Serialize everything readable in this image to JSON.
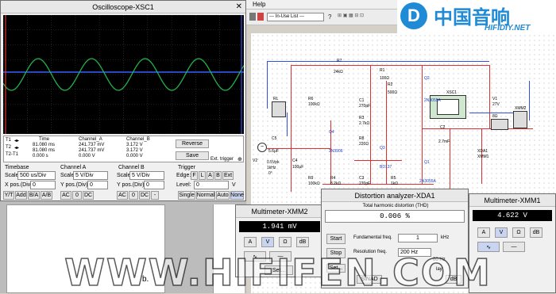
{
  "menu": {
    "help": "Help",
    "in_use_list": "--- In-Use List ---"
  },
  "brand": {
    "cn": "中国音响",
    "en": "HIFIDIY.NET",
    "color": "#1f8ad6"
  },
  "watermark": {
    "text": "WWW.HIFIFEN.COM"
  },
  "osc": {
    "title": "Oscilloscope-XSC1",
    "trace_color": "#22b14c",
    "cursor_labels": [
      "T1",
      "T2",
      "T2-T1"
    ],
    "head": {
      "time": "Time",
      "cha": "Channel_A",
      "chb": "Channel_B"
    },
    "rows": [
      {
        "time": "81.080 ms",
        "a": "241.737 mV",
        "b": "3.172 V"
      },
      {
        "time": "81.080 ms",
        "a": "241.737 mV",
        "b": "3.172 V"
      },
      {
        "time": "0.000 s",
        "a": "0.000 V",
        "b": "0.000 V"
      }
    ],
    "reverse": "Reverse",
    "save": "Save",
    "ext_trigger": "Ext. trigger",
    "timebase": {
      "title": "Timebase",
      "scale_lbl": "Scale:",
      "scale": "500 us/Div",
      "xpos_lbl": "X pos.(Div):",
      "xpos": "0",
      "modes": [
        "Y/T",
        "Add",
        "B/A",
        "A/B"
      ]
    },
    "cha": {
      "title": "Channel A",
      "scale_lbl": "Scale:",
      "scale": "5 V/Div",
      "ypos_lbl": "Y pos.(Div):",
      "ypos": "0",
      "modes": [
        "AC",
        "0",
        "DC"
      ]
    },
    "chb": {
      "title": "Channel B",
      "scale_lbl": "Scale:",
      "scale": "5 V/Div",
      "ypos_lbl": "Y pos.(Div):",
      "ypos": "0",
      "modes": [
        "AC",
        "0",
        "DC",
        "-"
      ]
    },
    "trig": {
      "title": "Trigger",
      "edge_lbl": "Edge:",
      "edge": [
        "F",
        "L",
        "A",
        "B",
        "Ext"
      ],
      "level_lbl": "Level:",
      "level": "0",
      "unit": "V",
      "modes": [
        "Single",
        "Normal",
        "Auto",
        "None"
      ]
    }
  },
  "schem": {
    "labels": [
      {
        "id": "R7",
        "t": "R7"
      },
      {
        "id": "R7v",
        "t": "24kΩ"
      },
      {
        "id": "R1",
        "t": "R1"
      },
      {
        "id": "R1v",
        "t": "100Ω"
      },
      {
        "id": "R2",
        "t": "R2"
      },
      {
        "id": "R2v",
        "t": "500Ω"
      },
      {
        "id": "Q2",
        "t": "Q2"
      },
      {
        "id": "XSC1",
        "t": "XSC1"
      },
      {
        "id": "V1",
        "t": "V1"
      },
      {
        "id": "V1v",
        "t": "27V"
      },
      {
        "id": "R6",
        "t": "R6"
      },
      {
        "id": "R6v",
        "t": "100kΩ"
      },
      {
        "id": "C1",
        "t": "C1"
      },
      {
        "id": "C1v",
        "t": "270pF"
      },
      {
        "id": "R3",
        "t": "R3"
      },
      {
        "id": "R3v",
        "t": "2.7kΩ"
      },
      {
        "id": "Q4",
        "t": "Q4"
      },
      {
        "id": "C5",
        "t": "C5"
      },
      {
        "id": "C5v",
        "t": "5.6μF"
      },
      {
        "id": "R8",
        "t": "R8"
      },
      {
        "id": "R8v",
        "t": "220Ω"
      },
      {
        "id": "Q3",
        "t": "Q3"
      },
      {
        "id": "C2",
        "t": "C2"
      },
      {
        "id": "C2v",
        "t": "2.7mF"
      },
      {
        "id": "Q5",
        "t": "2N3055A"
      },
      {
        "id": "2N3906",
        "t": "2N3906"
      },
      {
        "id": "BD137",
        "t": "BD137"
      },
      {
        "id": "V2",
        "t": "V2"
      },
      {
        "id": "V2v",
        "t": "0.5Vpk"
      },
      {
        "id": "V2f",
        "t": "1kHz"
      },
      {
        "id": "V2p",
        "t": "0°"
      },
      {
        "id": "C4",
        "t": "C4"
      },
      {
        "id": "C4v",
        "t": "100μF"
      },
      {
        "id": "R9",
        "t": "R9"
      },
      {
        "id": "R9v",
        "t": "100kΩ"
      },
      {
        "id": "R4",
        "t": "R4"
      },
      {
        "id": "R4v",
        "t": "8.2kΩ"
      },
      {
        "id": "C3",
        "t": "C3"
      },
      {
        "id": "C3v",
        "t": "270pF"
      },
      {
        "id": "R5",
        "t": "R5"
      },
      {
        "id": "R5v",
        "t": "1kΩ"
      },
      {
        "id": "Q1",
        "t": "Q1"
      },
      {
        "id": "Q1t",
        "t": "2N3055A"
      },
      {
        "id": "RL",
        "t": "RL"
      },
      {
        "id": "RLv",
        "t": "8Ω"
      },
      {
        "id": "XMM2",
        "t": "XMM2"
      },
      {
        "id": "XDA1",
        "t": "XDA1"
      },
      {
        "id": "XMM1",
        "t": "XMM1"
      }
    ]
  },
  "mm2": {
    "title": "Multimeter-XMM2",
    "reading": "1.941 mV",
    "btns": [
      "A",
      "V",
      "Ω",
      "dB"
    ],
    "set": "Set..."
  },
  "da": {
    "title": "Distortion analyzer-XDA1",
    "thd_lbl": "Total harmonic distortion (THD)",
    "thd": "0.006 %",
    "start": "Start",
    "stop": "Stop",
    "fund_lbl": "Fundamental freq.",
    "fund": "1",
    "fund_unit": "kHz",
    "res_lbl": "Resolution freq.",
    "res": "200 Hz",
    "res_unit": "00 Hz",
    "display": "lay",
    "sinad": "SINAD",
    "set": "Set...",
    "db": "dB"
  },
  "mm1": {
    "title": "Multimeter-XMM1",
    "reading": "4.622 V",
    "btns": [
      "A",
      "V",
      "Ω",
      "dB"
    ]
  },
  "bottom_text": "b."
}
